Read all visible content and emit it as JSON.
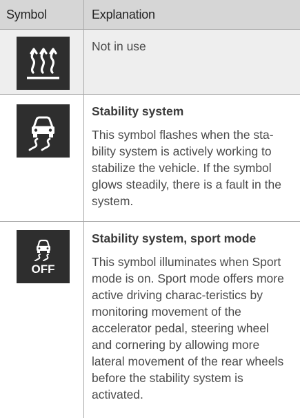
{
  "header": {
    "symbol_label": "Symbol",
    "explanation_label": "Explanation"
  },
  "rows": [
    {
      "icon": "defroster-heat-icon",
      "title": "",
      "text": "Not in use"
    },
    {
      "icon": "stability-system-icon",
      "title": "Stability system",
      "text": "This symbol flashes when the sta-bility system is actively working to stabilize the vehicle. If the symbol glows steadily, there is a fault in the system."
    },
    {
      "icon": "stability-system-off-icon",
      "icon_text": "OFF",
      "title": "Stability system, sport mode",
      "text": "This symbol illuminates when Sport mode is on. Sport mode offers more active driving charac-teristics by monitoring movement of the accelerator pedal, steering wheel and cornering by allowing more lateral movement of the rear wheels before the stability system is activated."
    }
  ],
  "colors": {
    "header_bg": "#d6d6d6",
    "row_bg": "#eeeeee",
    "icon_bg": "#2e2e2e",
    "icon_fg": "#ffffff",
    "divider": "#a8a8a8"
  }
}
